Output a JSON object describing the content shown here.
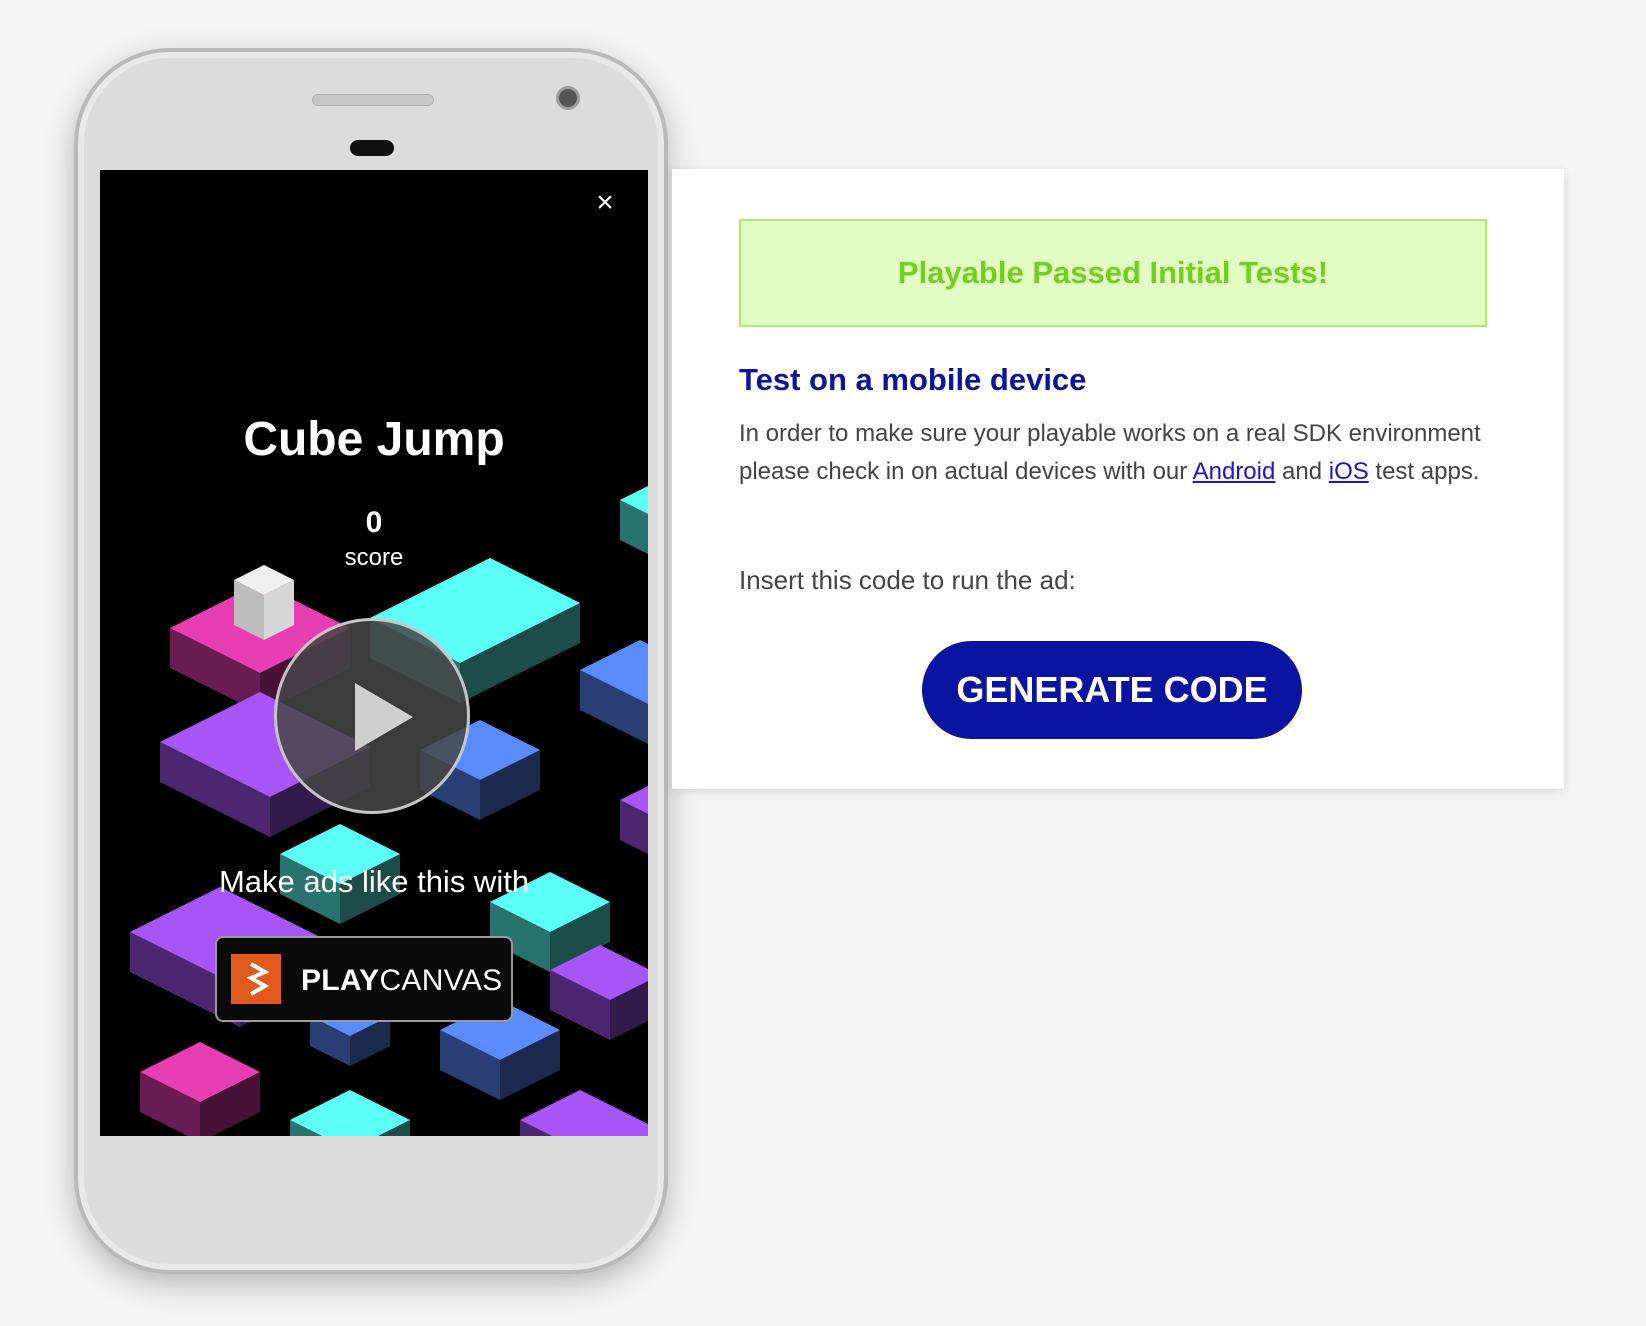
{
  "ad": {
    "title": "Cube Jump",
    "score_value": "0",
    "score_label": "score",
    "close_icon": "×",
    "promo_text": "Make ads like this with",
    "brand": {
      "bold": "PLAY",
      "light": "CANVAS"
    }
  },
  "panel": {
    "status_banner": "Playable Passed Initial Tests!",
    "section_title": "Test on a mobile device",
    "desc_before": "In order to make sure your playable works on a real SDK environment please check in on actual devices with our ",
    "link_android": "Android",
    "desc_and": " and ",
    "link_ios": "iOS",
    "desc_after": " test apps.",
    "insert_label": "Insert this code to run the ad:",
    "generate_button": "GENERATE CODE"
  },
  "colors": {
    "accent_blue": "#0a14a0",
    "success_green": "#72cf1d",
    "success_bg": "#e2fdc3",
    "tile_pink": "#e83eb4",
    "tile_cyan": "#5cfff5",
    "tile_purple": "#a855f7",
    "tile_blue": "#5a8cff",
    "brand_orange": "#e05a1e"
  },
  "icons": [
    "close-icon",
    "play-icon",
    "playcanvas-logo-icon"
  ]
}
